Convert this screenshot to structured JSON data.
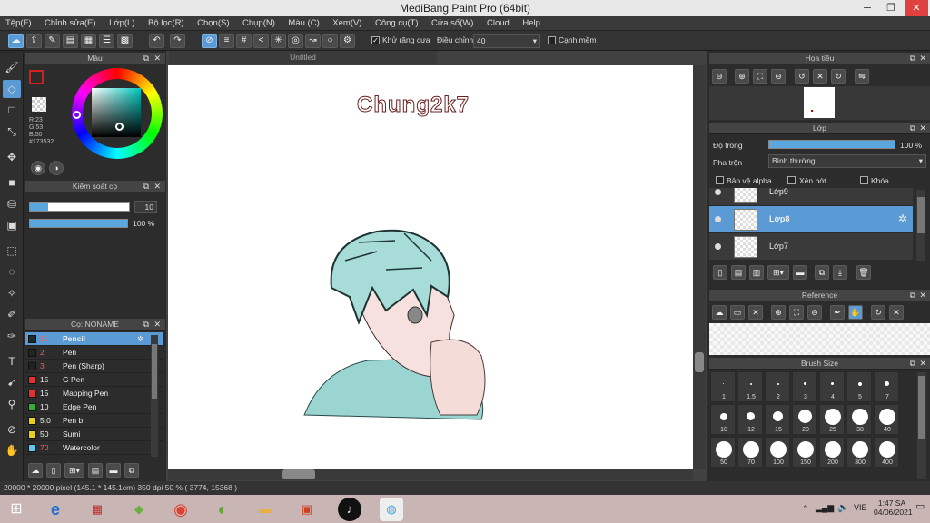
{
  "window": {
    "title": "MediBang Paint Pro (64bit)",
    "min": "─",
    "max": "❐",
    "close": "✕"
  },
  "menu": [
    "Tệp(F)",
    "Chỉnh sửa(E)",
    "Lớp(L)",
    "Bộ lọc(R)",
    "Chọn(S)",
    "Chụp(N)",
    "Màu (C)",
    "Xem(V)",
    "Công cụ(T)",
    "Cửa số(W)",
    "Cloud",
    "Help"
  ],
  "toolbar": {
    "antialias_label": "Khử răng cưa",
    "adjust_label": "Điều chỉnh",
    "adjust_value": "40",
    "smooth_label": "Cạnh mềm"
  },
  "color_panel": {
    "title": "Màu",
    "r": "R:23",
    "g": "G:53",
    "b": "B:50",
    "hex": "#173532"
  },
  "brush_control": {
    "title": "Kiểm soát cọ",
    "size": "10",
    "opacity": "100 %"
  },
  "brush_panel": {
    "title": "Cọ: NONAME",
    "items": [
      {
        "size": "15",
        "name": "Pencil",
        "color": "#1e2a2a"
      },
      {
        "size": "2",
        "name": "Pen",
        "color": "#222222"
      },
      {
        "size": "3",
        "name": "Pen (Sharp)",
        "color": "#222222"
      },
      {
        "size": "15",
        "name": "G Pen",
        "color": "#e03030"
      },
      {
        "size": "15",
        "name": "Mapping Pen",
        "color": "#e03030"
      },
      {
        "size": "10",
        "name": "Edge Pen",
        "color": "#30b030"
      },
      {
        "size": "5.0",
        "name": "Pen b",
        "color": "#e8d020"
      },
      {
        "size": "50",
        "name": "Sumi",
        "color": "#e8d020"
      },
      {
        "size": "70",
        "name": "Watercolor",
        "color": "#60c8f0"
      }
    ]
  },
  "canvas": {
    "tab": "Untitled",
    "text": "Chung2k7"
  },
  "navigator": {
    "title": "Họa tiêu"
  },
  "layer_panel": {
    "title": "Lớp",
    "opacity_label": "Độ trong",
    "opacity_value": "100 %",
    "blend_label": "Pha trộn",
    "blend_value": "Bình thường",
    "protect_alpha": "Bảo vệ alpha",
    "clipping": "Xén bớt",
    "lock": "Khóa",
    "layers": [
      "Lớp9",
      "Lớp8",
      "Lớp7"
    ]
  },
  "reference": {
    "title": "Reference"
  },
  "brush_size": {
    "title": "Brush Size",
    "sizes": [
      "1",
      "1.5",
      "2",
      "3",
      "4",
      "5",
      "7",
      "10",
      "12",
      "15",
      "20",
      "25",
      "30",
      "40",
      "50",
      "70",
      "100",
      "150",
      "200",
      "300",
      "400"
    ]
  },
  "status": {
    "text": "20000 * 20000 pixel   (145.1 * 145.1cm)   350 dpi   50 %   ( 3774, 15368 )"
  },
  "taskbar": {
    "lang": "VIE",
    "time": "1:47 SA",
    "date": "04/06/2021"
  }
}
